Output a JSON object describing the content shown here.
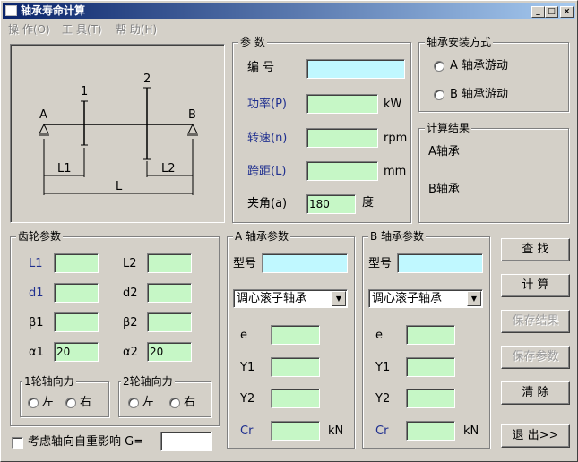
{
  "window": {
    "title": "轴承寿命计算"
  },
  "menu": [
    "操 作(O)",
    "工 具(T)",
    "帮 助(H)"
  ],
  "diagram": {
    "label_A": "A",
    "label_B": "B",
    "label_1": "1",
    "label_2": "2",
    "label_L1": "L1",
    "label_L2": "L2",
    "label_L": "L"
  },
  "params": {
    "title": "参  数",
    "code_label": "编 号",
    "power_label": "功率(P)",
    "power_unit": "kW",
    "speed_label": "转速(n)",
    "speed_unit": "rpm",
    "span_label": "跨距(L)",
    "span_unit": "mm",
    "angle_label": "夹角(a)",
    "angle_value": "180",
    "angle_unit": "度"
  },
  "install": {
    "title": "轴承安装方式",
    "optionA": "A  轴承游动",
    "optionB": "B  轴承游动"
  },
  "result": {
    "title": "计算结果",
    "a_label": "A轴承",
    "b_label": "B轴承"
  },
  "gear": {
    "title": "齿轮参数",
    "L1": "L1",
    "L2": "L2",
    "d1": "d1",
    "d2": "d2",
    "beta1": "β1",
    "beta2": "β2",
    "alpha1": "α1",
    "alpha2": "α2",
    "alpha1_value": "20",
    "alpha2_value": "20",
    "force1_title": "1轮轴向力",
    "force2_title": "2轮轴向力",
    "left": "左",
    "right": "右"
  },
  "bearingA": {
    "title": "A 轴承参数",
    "model_label": "型号",
    "type_value": "调心滚子轴承",
    "e": "e",
    "Y1": "Y1",
    "Y2": "Y2",
    "Cr": "Cr",
    "unit": "kN"
  },
  "bearingB": {
    "title": "B 轴承参数",
    "model_label": "型号",
    "type_value": "调心滚子轴承",
    "e": "e",
    "Y1": "Y1",
    "Y2": "Y2",
    "Cr": "Cr",
    "unit": "kN"
  },
  "buttons": {
    "find": "查  找",
    "calc": "计  算",
    "save_result": "保存结果",
    "save_params": "保存参数",
    "clear": "清  除",
    "exit": "退 出>>"
  },
  "weight": {
    "label": "考虑轴向自重影响  G="
  },
  "colors": {
    "field_green": "#c6f7c6",
    "field_cyan": "#c0f8ff",
    "title_blue": "#0a246a",
    "label_blue": "#1f2f8f"
  },
  "icons": {
    "minimize": "_",
    "maximize": "□",
    "close": "×",
    "dropdown": "▼"
  }
}
